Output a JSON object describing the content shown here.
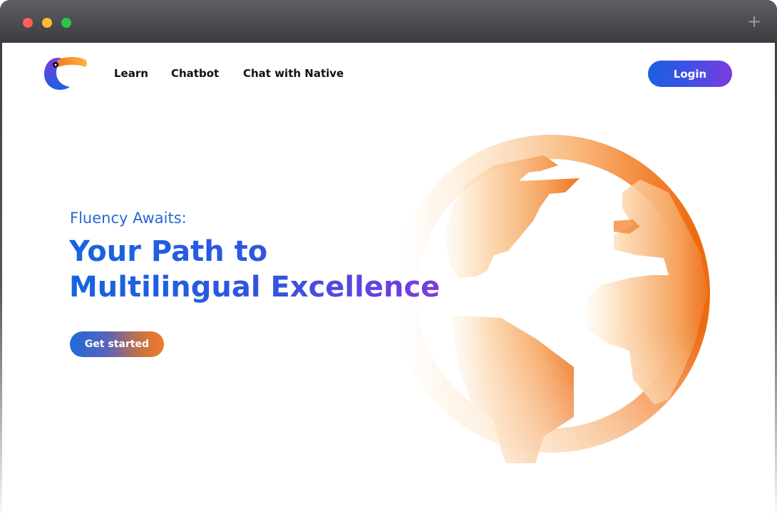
{
  "window": {
    "controls": [
      "close",
      "minimize",
      "maximize"
    ],
    "new_tab_icon": "plus-icon"
  },
  "header": {
    "logo": "toucan-logo",
    "nav": [
      {
        "label": "Learn"
      },
      {
        "label": "Chatbot"
      },
      {
        "label": "Chat with Native"
      }
    ],
    "login_label": "Login"
  },
  "hero": {
    "eyebrow": "Fluency Awaits:",
    "headline_line1": "Your Path to",
    "headline_line2": "Multilingual Excellence",
    "cta_label": "Get started",
    "illustration": "globe-illustration"
  },
  "colors": {
    "primary_blue": "#1c5fe0",
    "accent_purple": "#7a3bde",
    "accent_orange": "#f07a2a",
    "eyebrow_text": "#2a66d9"
  }
}
